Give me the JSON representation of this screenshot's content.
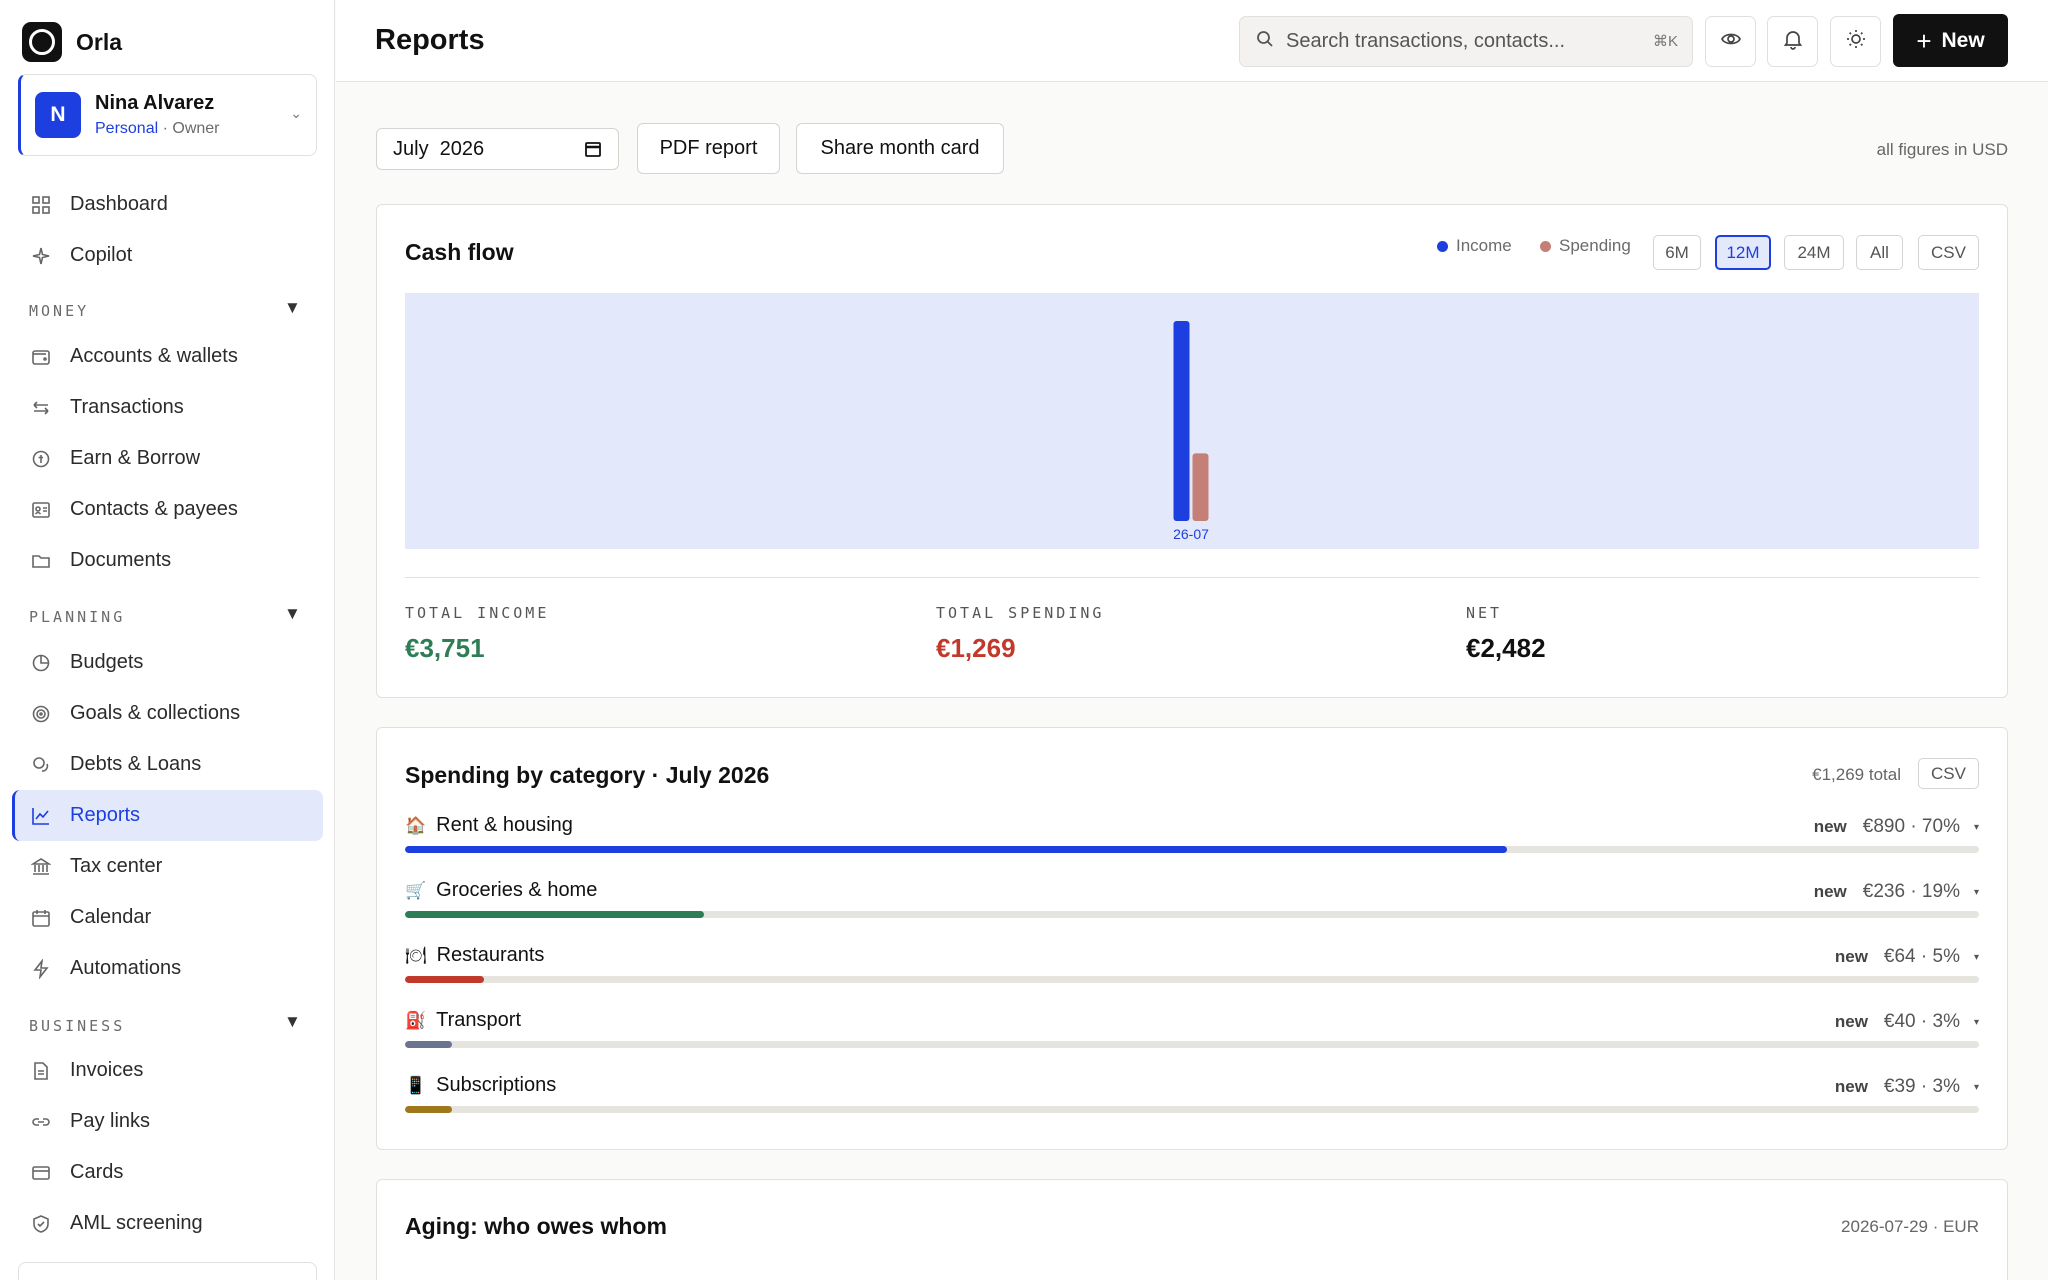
{
  "brand": {
    "name": "Orla"
  },
  "account": {
    "initial": "N",
    "name": "Nina Alvarez",
    "type": "Personal",
    "role": "· Owner"
  },
  "nav": {
    "dashboard": "Dashboard",
    "copilot": "Copilot",
    "money_label": "MONEY",
    "accounts": "Accounts & wallets",
    "transactions": "Transactions",
    "earn": "Earn & Borrow",
    "contacts": "Contacts & payees",
    "documents": "Documents",
    "planning_label": "PLANNING",
    "budgets": "Budgets",
    "goals": "Goals & collections",
    "debts": "Debts & Loans",
    "reports": "Reports",
    "tax": "Tax center",
    "calendar": "Calendar",
    "automations": "Automations",
    "business_label": "BUSINESS",
    "invoices": "Invoices",
    "paylinks": "Pay links",
    "cards": "Cards",
    "aml": "AML screening"
  },
  "topbar": {
    "title": "Reports",
    "search_placeholder": "Search transactions, contacts...",
    "search_shortcut": "⌘K",
    "new_label": "New"
  },
  "toolbar": {
    "month_value": "July  2026",
    "pdf_label": "PDF report",
    "share_label": "Share month card",
    "figures_note": "all figures in USD"
  },
  "cashflow": {
    "title": "Cash flow",
    "legend_income": "Income",
    "legend_spending": "Spending",
    "range_6m": "6M",
    "range_12m": "12M",
    "range_24m": "24M",
    "range_all": "All",
    "csv": "CSV",
    "total_income_label": "TOTAL INCOME",
    "total_income": "€3,751",
    "total_spending_label": "TOTAL SPENDING",
    "total_spending": "€1,269",
    "net_label": "NET",
    "net": "€2,482",
    "colors": {
      "income": "#1d3fe0",
      "spending": "#c47f77",
      "positive": "#2e7d56",
      "negative": "#c0392b"
    }
  },
  "chart_data": {
    "type": "bar",
    "categories": [
      "26-07"
    ],
    "series": [
      {
        "name": "Income",
        "values": [
          3751
        ]
      },
      {
        "name": "Spending",
        "values": [
          1269
        ]
      }
    ],
    "ylim": [
      0,
      3751
    ]
  },
  "spending": {
    "title": "Spending by category · July 2026",
    "total": "€1,269 total",
    "csv": "CSV",
    "categories": [
      {
        "emoji": "🏠",
        "name": "Rent & housing",
        "tag": "new",
        "value": "€890 · 70%",
        "pct": 70,
        "color": "#1d3fe0"
      },
      {
        "emoji": "🛒",
        "name": "Groceries & home",
        "tag": "new",
        "value": "€236 · 19%",
        "pct": 19,
        "color": "#2e7d56"
      },
      {
        "emoji": "🍽",
        "name": "Restaurants",
        "tag": "new",
        "value": "€64 · 5%",
        "pct": 5,
        "color": "#c0392b"
      },
      {
        "emoji": "⛽",
        "name": "Transport",
        "tag": "new",
        "value": "€40 · 3%",
        "pct": 3,
        "color": "#6b7390"
      },
      {
        "emoji": "📱",
        "name": "Subscriptions",
        "tag": "new",
        "value": "€39 · 3%",
        "pct": 3,
        "color": "#a0781c"
      }
    ]
  },
  "aging": {
    "title": "Aging: who owes whom",
    "meta": "2026-07-29 · EUR"
  }
}
